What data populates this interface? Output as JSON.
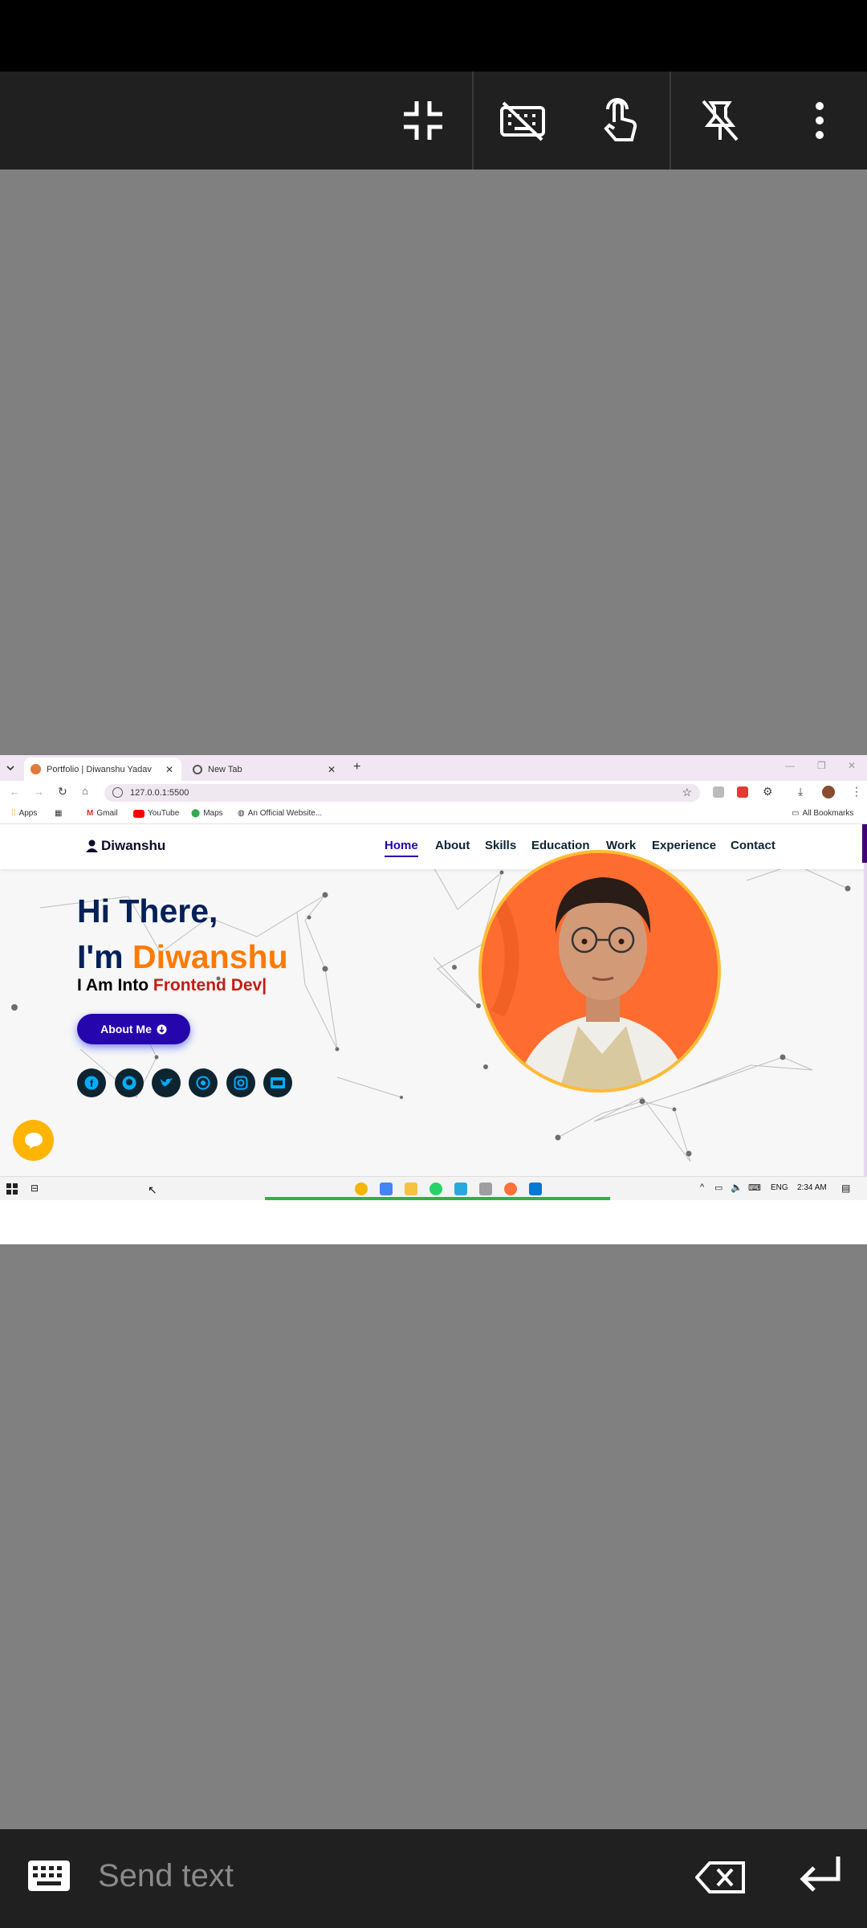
{
  "toolbar": {
    "icons": [
      "exit-fullscreen-icon",
      "keyboard-off-icon",
      "touch-mode-icon",
      "unpin-icon",
      "more-vert-icon"
    ]
  },
  "browser": {
    "tabs": [
      {
        "title": "Portfolio | Diwanshu Yadav",
        "active": true
      },
      {
        "title": "New Tab",
        "active": false
      }
    ],
    "url": "127.0.0.1:5500",
    "bookmarks": [
      "Apps",
      "Gmail",
      "YouTube",
      "Maps",
      "An Official Website..."
    ],
    "all_bookmarks": "All Bookmarks"
  },
  "site": {
    "brand": "Diwanshu",
    "nav": [
      "Home",
      "About",
      "Skills",
      "Education",
      "Work",
      "Experience",
      "Contact"
    ],
    "hero_line1": "Hi There,",
    "hero_im": "I'm",
    "hero_name": "Diwanshu",
    "typed_prefix": "I Am Into",
    "typed_value": "Frontend Dev|",
    "about_button": "About Me",
    "socials": [
      "facebook-icon",
      "github-icon",
      "twitter-icon",
      "whatsapp-icon",
      "instagram-icon",
      "dev-icon"
    ]
  },
  "taskbar": {
    "lang": "ENG",
    "time": "2:34 AM"
  },
  "ime": {
    "placeholder": "Send text"
  },
  "colors": {
    "accent": "#2506ad",
    "name_orange": "#ff7a00",
    "typed_red": "#c31d13",
    "navy": "#002057"
  }
}
